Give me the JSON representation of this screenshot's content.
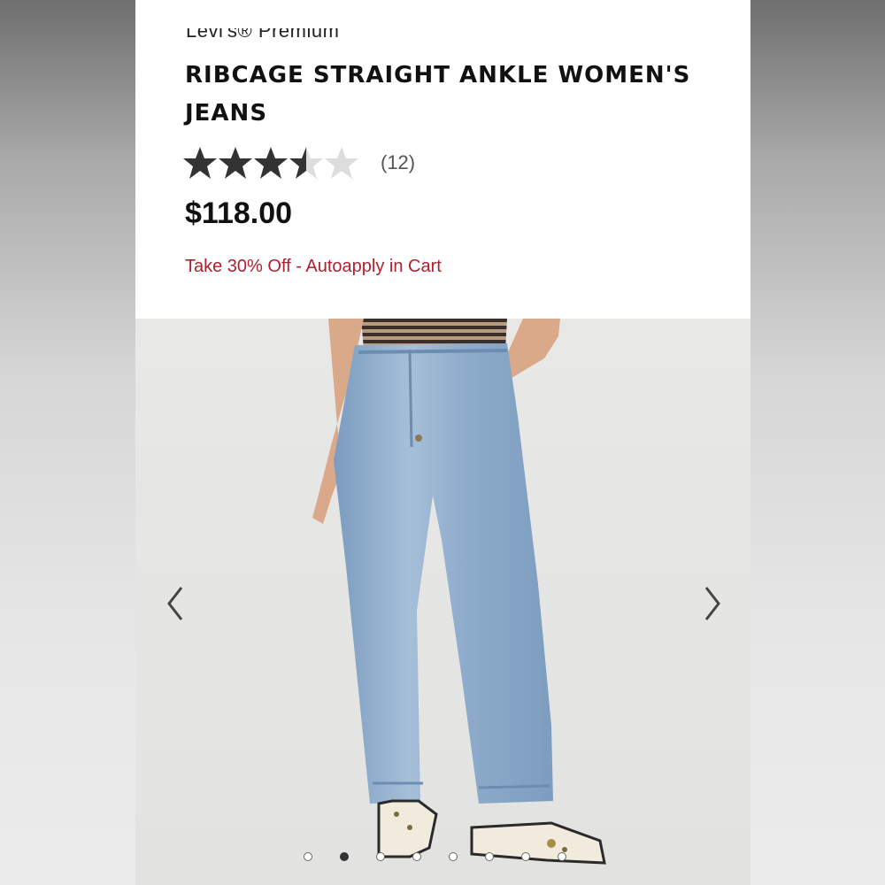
{
  "product": {
    "brand": "Levi's® Premium",
    "title": "RIBCAGE STRAIGHT ANKLE WOMEN'S JEANS",
    "rating": 3.5,
    "rating_max": 5,
    "review_count": "(12)",
    "price": "$118.00",
    "promo": "Take 30% Off - Autoapply in Cart"
  },
  "gallery": {
    "dots_count": 8,
    "active_index": 1,
    "prev_icon": "chevron-left-icon",
    "next_icon": "chevron-right-icon"
  },
  "colors": {
    "accent_red": "#b0202e",
    "star_filled": "#333333",
    "star_empty": "#dddddd"
  }
}
